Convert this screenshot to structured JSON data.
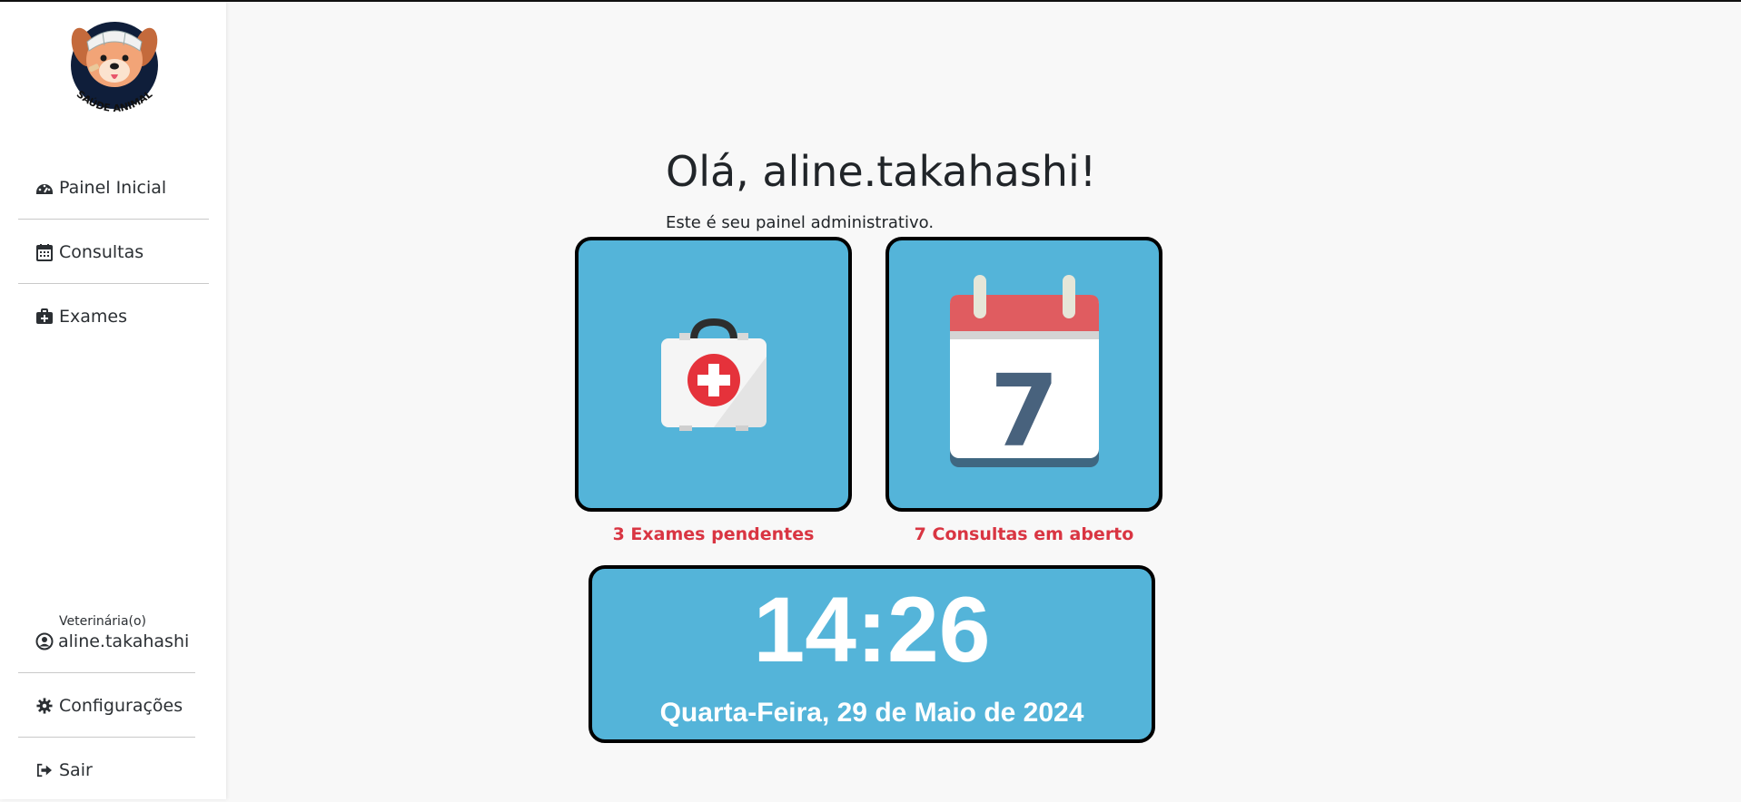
{
  "brand": {
    "logo_text": "SAÚDE ANIMAL"
  },
  "sidebar": {
    "nav": [
      {
        "label": "Painel Inicial",
        "icon": "dashboard-icon"
      },
      {
        "label": "Consultas",
        "icon": "calendar-icon"
      },
      {
        "label": "Exames",
        "icon": "medkit-icon"
      }
    ],
    "user": {
      "role": "Veterinária(o)",
      "name": "aline.takahashi",
      "icon": "user-circle-icon"
    },
    "bottom": [
      {
        "label": "Configurações",
        "icon": "gear-icon"
      },
      {
        "label": "Sair",
        "icon": "sign-out-icon"
      }
    ]
  },
  "main": {
    "greeting": "Olá, aline.takahashi!",
    "subtitle": "Este é seu painel administrativo.",
    "cards": [
      {
        "label": "3 Exames pendentes",
        "icon": "first-aid-kit-icon"
      },
      {
        "label": "7 Consultas em aberto",
        "icon": "calendar-7-icon",
        "day": "7"
      }
    ],
    "clock": {
      "time": "14:26",
      "date": "Quarta-Feira, 29 de Maio de 2024"
    }
  },
  "colors": {
    "card_bg": "#54b4d9",
    "card_label": "#d93542",
    "sidebar_bg": "#ffffff",
    "page_bg": "#f8f8f8"
  }
}
